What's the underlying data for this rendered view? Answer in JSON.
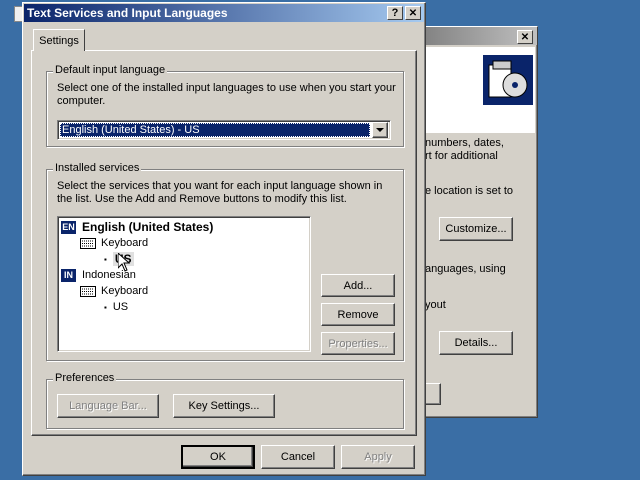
{
  "main_dialog": {
    "title": "Text Services and Input Languages",
    "help_glyph": "?",
    "close_glyph": "✕",
    "tabs": [
      {
        "label": "Settings"
      }
    ],
    "default_input_language": {
      "group_title": "Default input language",
      "description": "Select one of the installed input languages to use when you start your computer.",
      "selected_value": "English (United States) - US"
    },
    "installed_services": {
      "group_title": "Installed services",
      "description": "Select the services that you want for each input language shown in the list. Use the Add and Remove buttons to modify this list.",
      "tree": [
        {
          "badge": "EN",
          "language": "English (United States)",
          "category": "Keyboard",
          "layout": "US"
        },
        {
          "badge": "IN",
          "language": "Indonesian",
          "category": "Keyboard",
          "layout": "US"
        }
      ],
      "bullet": "▪",
      "add_label": "Add...",
      "remove_label": "Remove",
      "properties_label": "Properties..."
    },
    "preferences": {
      "group_title": "Preferences",
      "language_bar_label": "Language Bar...",
      "key_settings_label": "Key Settings..."
    },
    "ok_label": "OK",
    "cancel_label": "Cancel",
    "apply_label": "Apply"
  },
  "background_dialog": {
    "close_glyph": "✕",
    "text_line_1": "numbers, dates,",
    "text_line_2": "rt for additional",
    "text_line_3": "e location is set to",
    "customize_label": "Customize...",
    "text_line_4": "anguages, using",
    "text_line_5": "yout",
    "details_label": "Details..."
  },
  "colors": {
    "desktop": "#3a6ea5",
    "titlebar_active": "#0a246a",
    "titlebar_inactive": "#808080",
    "face": "#d4d0c8",
    "selection": "#0a246a"
  }
}
